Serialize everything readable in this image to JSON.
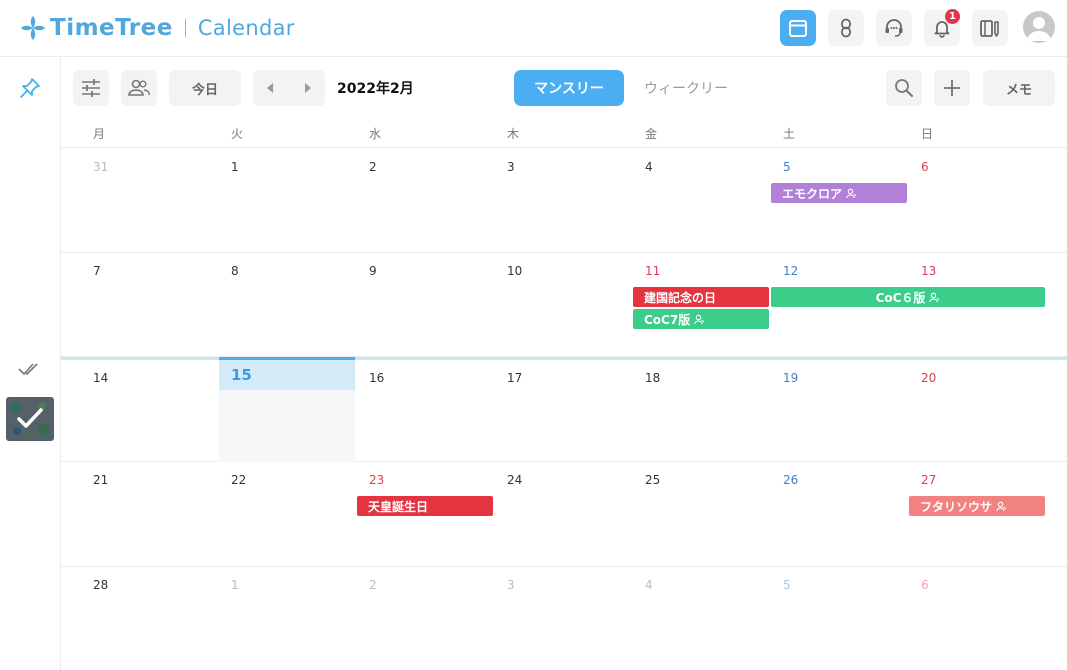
{
  "app": {
    "logo_text": "TimeTree",
    "logo_sub": "Calendar",
    "notification_count": "1",
    "accent_color": "#4aaef0"
  },
  "toolbar": {
    "today_label": "今日",
    "month_label": "2022年2月",
    "monthly_tab": "マンスリー",
    "weekly_tab": "ウィークリー",
    "memo_label": "メモ"
  },
  "calendar": {
    "weekdays": [
      "月",
      "火",
      "水",
      "木",
      "金",
      "土",
      "日"
    ],
    "weeks": [
      [
        "31",
        "1",
        "2",
        "3",
        "4",
        "5",
        "6"
      ],
      [
        "7",
        "8",
        "9",
        "10",
        "11",
        "12",
        "13"
      ],
      [
        "14",
        "15",
        "16",
        "17",
        "18",
        "19",
        "20"
      ],
      [
        "21",
        "22",
        "23",
        "24",
        "25",
        "26",
        "27"
      ],
      [
        "28",
        "1",
        "2",
        "3",
        "4",
        "5",
        "6"
      ]
    ],
    "events": [
      {
        "label": "エモクロア",
        "color": "#b180d8",
        "shared": true
      },
      {
        "label": "建国記念の日",
        "color": "#e3343f",
        "shared": false
      },
      {
        "label": "CoC６版",
        "color": "#3ccd8b",
        "shared": true
      },
      {
        "label": "CoC7版",
        "color": "#3ccd8b",
        "shared": true
      },
      {
        "label": "天皇誕生日",
        "color": "#e3343f",
        "shared": false
      },
      {
        "label": "フタリソウサ",
        "color": "#f2827f",
        "shared": true
      }
    ]
  }
}
